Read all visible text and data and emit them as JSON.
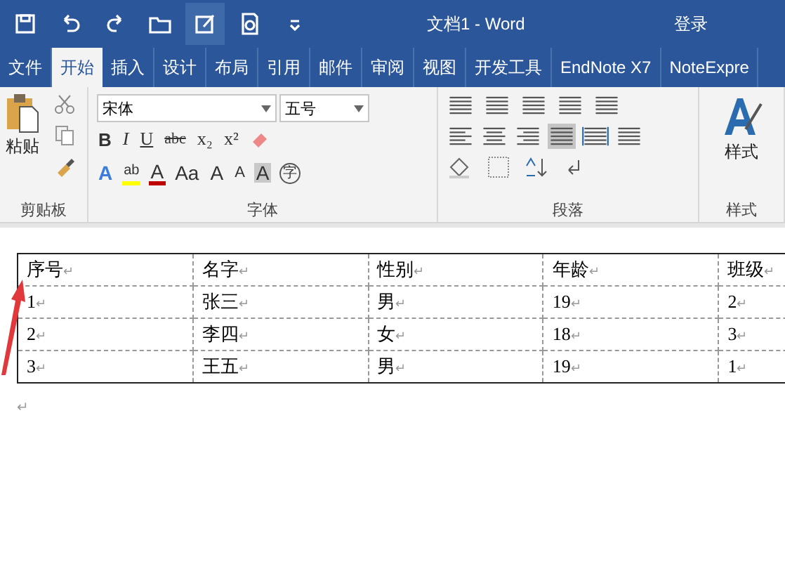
{
  "window": {
    "title": "文档1 - Word",
    "sign_in": "登录"
  },
  "tabs": [
    {
      "label": "文件",
      "selected": false
    },
    {
      "label": "开始",
      "selected": true
    },
    {
      "label": "插入",
      "selected": false
    },
    {
      "label": "设计",
      "selected": false
    },
    {
      "label": "布局",
      "selected": false
    },
    {
      "label": "引用",
      "selected": false
    },
    {
      "label": "邮件",
      "selected": false
    },
    {
      "label": "审阅",
      "selected": false
    },
    {
      "label": "视图",
      "selected": false
    },
    {
      "label": "开发工具",
      "selected": false
    },
    {
      "label": "EndNote X7",
      "selected": false
    },
    {
      "label": "NoteExpre",
      "selected": false
    }
  ],
  "ribbon": {
    "clipboard": {
      "paste": "粘贴",
      "label": "剪贴板"
    },
    "font": {
      "name": "宋体",
      "size": "五号",
      "label": "字体",
      "format_buttons": [
        {
          "kind": "bold",
          "label": "B"
        },
        {
          "kind": "italic",
          "label": "I"
        },
        {
          "kind": "underline",
          "label": "U"
        },
        {
          "kind": "strike",
          "label": "abc"
        },
        {
          "kind": "sub",
          "label": "x₂"
        },
        {
          "kind": "sup",
          "label": "x²"
        }
      ],
      "effect_buttons": [
        {
          "kind": "effect",
          "label": "A"
        },
        {
          "kind": "highlight",
          "label": "ab"
        },
        {
          "kind": "color",
          "label": "A"
        },
        {
          "kind": "case",
          "label": "Aa"
        },
        {
          "kind": "grow",
          "label": "A"
        },
        {
          "kind": "shrink",
          "label": "A"
        },
        {
          "kind": "shade",
          "label": "A"
        },
        {
          "kind": "enclose",
          "label": "字"
        }
      ]
    },
    "paragraph": {
      "label": "段落",
      "align_buttons": [
        {
          "kind": "left",
          "selected": false
        },
        {
          "kind": "center",
          "selected": false
        },
        {
          "kind": "right",
          "selected": false
        },
        {
          "kind": "justify",
          "selected": true
        },
        {
          "kind": "distributed",
          "selected": false
        }
      ]
    },
    "styles": {
      "button": "样式",
      "label": "样式"
    }
  },
  "document": {
    "mark": "↵",
    "columns": [
      "序号",
      "名字",
      "性别",
      "年龄",
      "班级"
    ],
    "rows": [
      [
        "1",
        "张三",
        "男",
        "19",
        "2"
      ],
      [
        "2",
        "李四",
        "女",
        "18",
        "3"
      ],
      [
        "3",
        "王五",
        "男",
        "19",
        "1"
      ]
    ]
  }
}
